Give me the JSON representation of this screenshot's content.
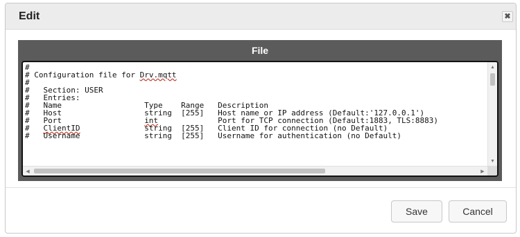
{
  "dialog": {
    "title": "Edit",
    "close_glyph": "✖",
    "close_icon": "close-icon"
  },
  "panel": {
    "header": "File"
  },
  "editor": {
    "lines": [
      "#",
      "# Configuration file for Drv.mqtt",
      "#",
      "#   Section: USER",
      "#   Entries:",
      "#   Name                  Type    Range   Description",
      "#   Host                  string  [255]   Host name or IP address (Default:'127.0.0.1')",
      "#   Port                  int             Port for TCP connection (Default:1883, TLS:8883)",
      "#   ClientID              string  [255]   Client ID for connection (no Default)",
      "#   Username              string  [255]   Username for authentication (no Default)"
    ],
    "scroll_up_glyph": "▲",
    "scroll_down_glyph": "▼",
    "scroll_left_glyph": "◀",
    "scroll_right_glyph": "▶"
  },
  "footer": {
    "save_label": "Save",
    "cancel_label": "Cancel"
  },
  "colors": {
    "titlebar_bg": "#ececec",
    "panel_header_bg": "#5b5b5b",
    "editor_border": "#111111",
    "spell_underline": "#c0392b"
  }
}
